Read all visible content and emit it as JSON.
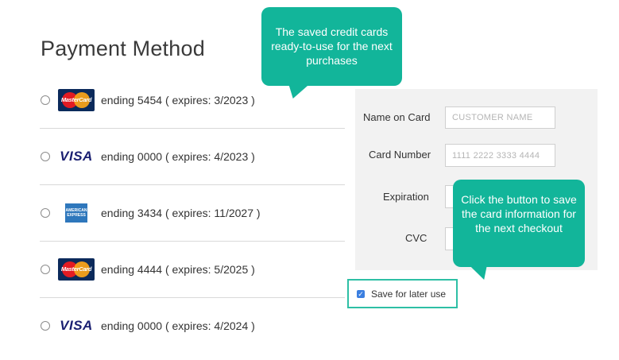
{
  "page_title": "Payment Method",
  "saved_cards": [
    {
      "brand": "mastercard",
      "brand_text": "MasterCard",
      "text": "ending 5454 ( expires: 3/2023 )"
    },
    {
      "brand": "visa",
      "brand_text": "VISA",
      "text": "ending 0000 ( expires: 4/2023 )"
    },
    {
      "brand": "amex",
      "brand_text": "AMERICAN EXPRESS",
      "text": "ending 3434 ( expires: 11/2027 )"
    },
    {
      "brand": "mastercard",
      "brand_text": "MasterCard",
      "text": "ending 4444 ( expires: 5/2025 )"
    },
    {
      "brand": "visa",
      "brand_text": "VISA",
      "text": "ending 0000 ( expires: 4/2024 )"
    }
  ],
  "form": {
    "name_label": "Name on Card",
    "name_placeholder": "CUSTOMER NAME",
    "number_label": "Card Number",
    "number_placeholder": "1111 2222 3333 4444",
    "expiration_label": "Expiration",
    "cvc_label": "CVC"
  },
  "save_for_later": {
    "label": "Save for later use",
    "checked": true
  },
  "callouts": {
    "saved_cards": "The saved credit cards ready-to-use for the next purchases",
    "save_button": "Click the button to save the card information for the next checkout"
  },
  "colors": {
    "callout": "#12b59a",
    "highlight_border": "#2ebfa5",
    "checkbox": "#3b7fe0"
  }
}
